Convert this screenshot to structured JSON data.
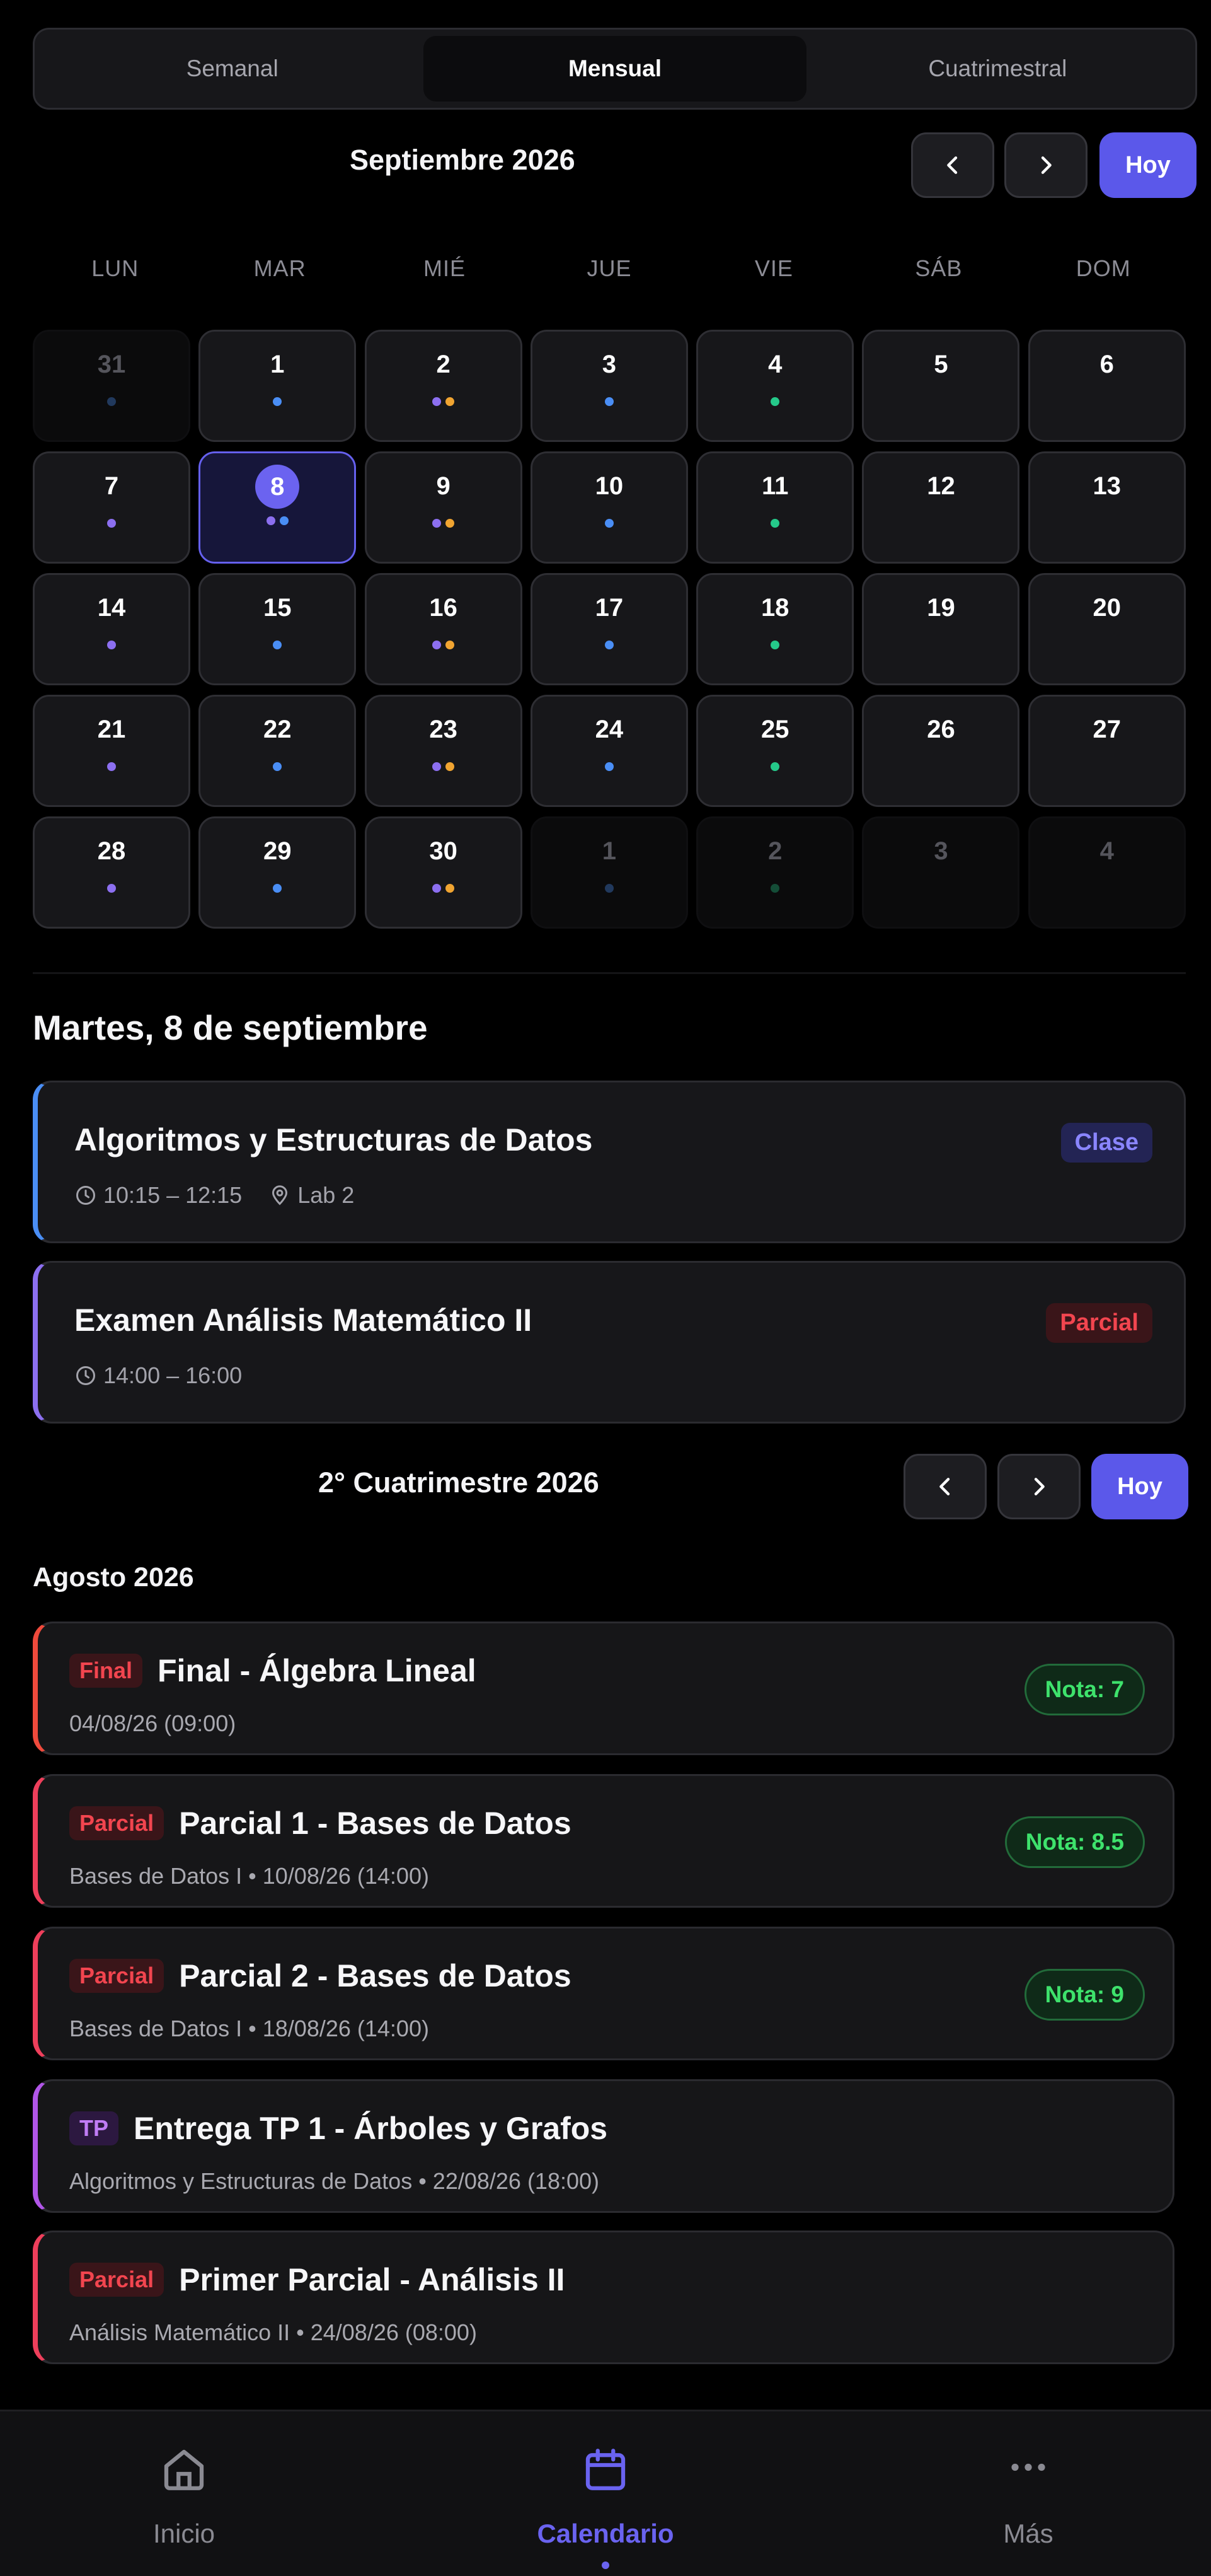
{
  "view_switcher": {
    "options": [
      "Semanal",
      "Mensual",
      "Cuatrimestral"
    ],
    "selected": "Mensual"
  },
  "month_nav": {
    "title": "Septiembre 2026",
    "today_label": "Hoy"
  },
  "calendar": {
    "weekdays": [
      "LUN",
      "MAR",
      "MIÉ",
      "JUE",
      "VIE",
      "SÁB",
      "DOM"
    ],
    "selected_day": 8,
    "dot_colors": {
      "purple": "#8c6ff0",
      "blue": "#4a8ef5",
      "orange": "#f0a431",
      "green": "#25c98a"
    },
    "days": [
      {
        "n": "31",
        "muted": true,
        "dots": [
          "blue"
        ]
      },
      {
        "n": "1",
        "muted": false,
        "dots": [
          "blue"
        ]
      },
      {
        "n": "2",
        "muted": false,
        "dots": [
          "purple",
          "orange"
        ]
      },
      {
        "n": "3",
        "muted": false,
        "dots": [
          "blue"
        ]
      },
      {
        "n": "4",
        "muted": false,
        "dots": [
          "green"
        ]
      },
      {
        "n": "5",
        "muted": false,
        "dots": []
      },
      {
        "n": "6",
        "muted": false,
        "dots": []
      },
      {
        "n": "7",
        "muted": false,
        "dots": [
          "purple"
        ]
      },
      {
        "n": "8",
        "muted": false,
        "dots": [
          "purple",
          "blue"
        ]
      },
      {
        "n": "9",
        "muted": false,
        "dots": [
          "purple",
          "orange"
        ]
      },
      {
        "n": "10",
        "muted": false,
        "dots": [
          "blue"
        ]
      },
      {
        "n": "11",
        "muted": false,
        "dots": [
          "green"
        ]
      },
      {
        "n": "12",
        "muted": false,
        "dots": []
      },
      {
        "n": "13",
        "muted": false,
        "dots": []
      },
      {
        "n": "14",
        "muted": false,
        "dots": [
          "purple"
        ]
      },
      {
        "n": "15",
        "muted": false,
        "dots": [
          "blue"
        ]
      },
      {
        "n": "16",
        "muted": false,
        "dots": [
          "purple",
          "orange"
        ]
      },
      {
        "n": "17",
        "muted": false,
        "dots": [
          "blue"
        ]
      },
      {
        "n": "18",
        "muted": false,
        "dots": [
          "green"
        ]
      },
      {
        "n": "19",
        "muted": false,
        "dots": []
      },
      {
        "n": "20",
        "muted": false,
        "dots": []
      },
      {
        "n": "21",
        "muted": false,
        "dots": [
          "purple"
        ]
      },
      {
        "n": "22",
        "muted": false,
        "dots": [
          "blue"
        ]
      },
      {
        "n": "23",
        "muted": false,
        "dots": [
          "purple",
          "orange"
        ]
      },
      {
        "n": "24",
        "muted": false,
        "dots": [
          "blue"
        ]
      },
      {
        "n": "25",
        "muted": false,
        "dots": [
          "green"
        ]
      },
      {
        "n": "26",
        "muted": false,
        "dots": []
      },
      {
        "n": "27",
        "muted": false,
        "dots": []
      },
      {
        "n": "28",
        "muted": false,
        "dots": [
          "purple"
        ]
      },
      {
        "n": "29",
        "muted": false,
        "dots": [
          "blue"
        ]
      },
      {
        "n": "30",
        "muted": false,
        "dots": [
          "purple",
          "orange"
        ]
      },
      {
        "n": "1",
        "muted": true,
        "dots": [
          "blue"
        ]
      },
      {
        "n": "2",
        "muted": true,
        "dots": [
          "green"
        ]
      },
      {
        "n": "3",
        "muted": true,
        "dots": []
      },
      {
        "n": "4",
        "muted": true,
        "dots": []
      }
    ]
  },
  "day_detail": {
    "heading": "Martes, 8 de septiembre",
    "events": [
      {
        "title": "Algoritmos y Estructuras de Datos",
        "time": "10:15 – 12:15",
        "location": "Lab 2",
        "badge": "Clase",
        "accent": "#4a8ef5",
        "badge_bg": "#232454",
        "badge_fg": "#8a85ff"
      },
      {
        "title": "Examen Análisis Matemático II",
        "time": "14:00 – 16:00",
        "badge": "Parcial",
        "accent": "#8c6ff0",
        "badge_bg": "#3a1519",
        "badge_fg": "#f2454f"
      }
    ]
  },
  "semester_nav": {
    "title": "2° Cuatrimestre 2026",
    "today_label": "Hoy"
  },
  "semester_list": {
    "month_label": "Agosto 2026",
    "items": [
      {
        "tag": "Final",
        "title": "Final - Álgebra Lineal",
        "subtitle": "04/08/26 (09:00)",
        "grade": "Nota: 7",
        "accent": "#ef4a3c",
        "tag_bg": "#3a1519",
        "tag_fg": "#f2454f"
      },
      {
        "tag": "Parcial",
        "title": "Parcial 1 - Bases de Datos",
        "subtitle": "Bases de Datos I • 10/08/26 (14:00)",
        "grade": "Nota: 8.5",
        "accent": "#ee3f5b",
        "tag_bg": "#3a1519",
        "tag_fg": "#f2454f"
      },
      {
        "tag": "Parcial",
        "title": "Parcial 2 - Bases de Datos",
        "subtitle": "Bases de Datos I • 18/08/26 (14:00)",
        "grade": "Nota: 9",
        "accent": "#ee3f5b",
        "tag_bg": "#3a1519",
        "tag_fg": "#f2454f"
      },
      {
        "tag": "TP",
        "title": "Entrega TP 1 - Árboles y Grafos",
        "subtitle": "Algoritmos y Estructuras de Datos • 22/08/26 (18:00)",
        "grade": "",
        "accent": "#b156e8",
        "tag_bg": "#2c1840",
        "tag_fg": "#c07cf5"
      },
      {
        "tag": "Parcial",
        "title": "Primer Parcial - Análisis II",
        "subtitle": "Análisis Matemático II • 24/08/26 (08:00)",
        "grade": "",
        "accent": "#ee3f5b",
        "tag_bg": "#3a1519",
        "tag_fg": "#f2454f"
      }
    ]
  },
  "bottom_nav": {
    "items": [
      {
        "label": "Inicio",
        "icon": "home-icon"
      },
      {
        "label": "Calendario",
        "icon": "calendar-icon"
      },
      {
        "label": "Más",
        "icon": "more-icon"
      }
    ],
    "active": "Calendario"
  }
}
